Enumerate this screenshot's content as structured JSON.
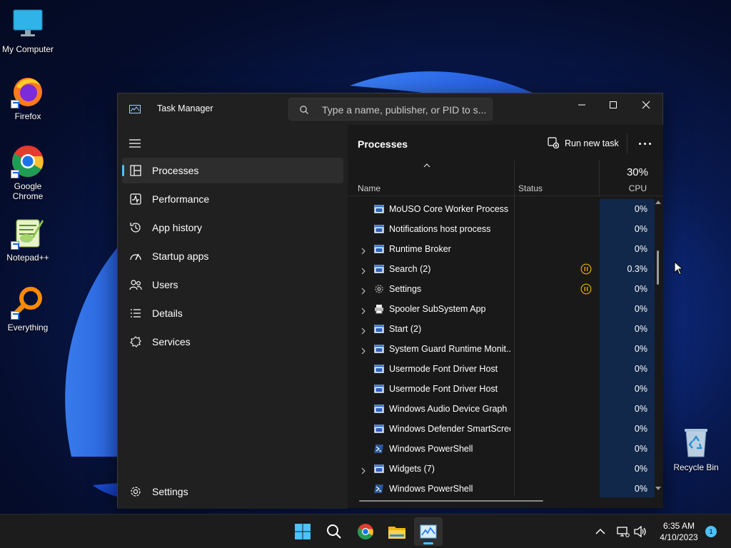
{
  "desktop": {
    "icons": [
      {
        "label": "My Computer"
      },
      {
        "label": "Firefox"
      },
      {
        "label": "Google Chrome"
      },
      {
        "label": "Notepad++"
      },
      {
        "label": "Everything"
      },
      {
        "label": "Recycle Bin"
      }
    ]
  },
  "task_manager": {
    "title": "Task Manager",
    "search_placeholder": "Type a name, publisher, or PID to s...",
    "window_controls": {
      "minimize": "minimize-icon",
      "maximize": "maximize-icon",
      "close": "close-icon"
    },
    "nav": [
      {
        "label": "Processes",
        "icon": "processes-icon",
        "active": true
      },
      {
        "label": "Performance",
        "icon": "performance-icon"
      },
      {
        "label": "App history",
        "icon": "history-icon"
      },
      {
        "label": "Startup apps",
        "icon": "startup-icon"
      },
      {
        "label": "Users",
        "icon": "users-icon"
      },
      {
        "label": "Details",
        "icon": "details-icon"
      },
      {
        "label": "Services",
        "icon": "services-icon"
      }
    ],
    "settings_label": "Settings",
    "main": {
      "title": "Processes",
      "run_new_task": "Run new task",
      "columns": {
        "name": "Name",
        "status": "Status",
        "cpu_total": "30%",
        "cpu": "CPU"
      },
      "rows": [
        {
          "name": "MoUSO Core Worker Process",
          "expandable": false,
          "icon": "window-icon",
          "status": "",
          "cpu": "0%"
        },
        {
          "name": "Notifications host process",
          "expandable": false,
          "icon": "window-icon",
          "status": "",
          "cpu": "0%"
        },
        {
          "name": "Runtime Broker",
          "expandable": true,
          "icon": "window-icon",
          "status": "",
          "cpu": "0%"
        },
        {
          "name": "Search (2)",
          "expandable": true,
          "icon": "window-icon",
          "status": "suspended",
          "cpu": "0.3%"
        },
        {
          "name": "Settings",
          "expandable": true,
          "icon": "gear-icon",
          "status": "suspended",
          "cpu": "0%"
        },
        {
          "name": "Spooler SubSystem App",
          "expandable": true,
          "icon": "printer-icon",
          "status": "",
          "cpu": "0%"
        },
        {
          "name": "Start (2)",
          "expandable": true,
          "icon": "window-icon",
          "status": "",
          "cpu": "0%"
        },
        {
          "name": "System Guard Runtime Monit...",
          "expandable": true,
          "icon": "window-icon",
          "status": "",
          "cpu": "0%"
        },
        {
          "name": "Usermode Font Driver Host",
          "expandable": false,
          "icon": "window-icon",
          "status": "",
          "cpu": "0%"
        },
        {
          "name": "Usermode Font Driver Host",
          "expandable": false,
          "icon": "window-icon",
          "status": "",
          "cpu": "0%"
        },
        {
          "name": "Windows Audio Device Graph ...",
          "expandable": false,
          "icon": "window-icon",
          "status": "",
          "cpu": "0%"
        },
        {
          "name": "Windows Defender SmartScreen",
          "expandable": false,
          "icon": "window-icon",
          "status": "",
          "cpu": "0%"
        },
        {
          "name": "Windows PowerShell",
          "expandable": false,
          "icon": "powershell-icon",
          "status": "",
          "cpu": "0%"
        },
        {
          "name": "Widgets (7)",
          "expandable": true,
          "icon": "window-icon",
          "status": "",
          "cpu": "0%"
        },
        {
          "name": "Windows PowerShell",
          "expandable": false,
          "icon": "powershell-icon",
          "status": "",
          "cpu": "0%"
        }
      ]
    }
  },
  "taskbar": {
    "apps": [
      "start-icon",
      "search-icon",
      "chrome-icon",
      "file-explorer-icon",
      "task-manager-icon"
    ],
    "time": "6:35 AM",
    "date": "4/10/2023",
    "notification_count": "1"
  },
  "colors": {
    "accent": "#4cc2ff",
    "cpu_cell": "#11284a",
    "status_paused": "#e0b000"
  }
}
